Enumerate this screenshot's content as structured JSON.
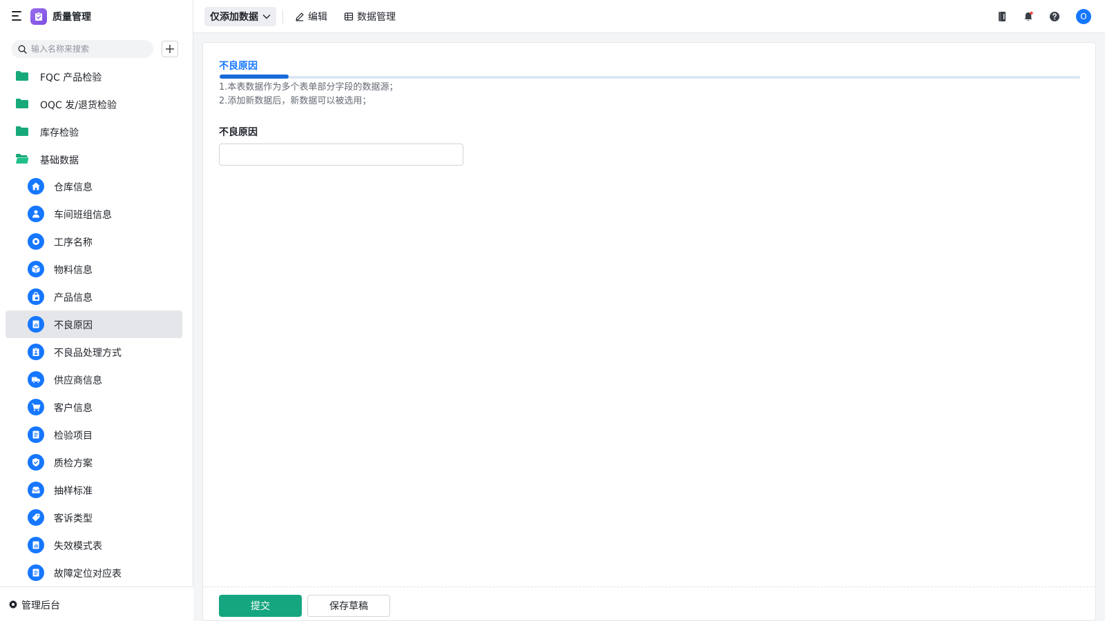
{
  "app": {
    "title": "质量管理",
    "logo_icon": "clipboard-check-icon"
  },
  "search": {
    "placeholder": "输入名称来搜索"
  },
  "sidebar": {
    "folders": [
      {
        "label": "FQC 产品检验"
      },
      {
        "label": "OQC 发/退货检验"
      },
      {
        "label": "库存检验"
      },
      {
        "label": "基础数据"
      }
    ],
    "items": [
      {
        "label": "仓库信息",
        "icon": "home-icon"
      },
      {
        "label": "车间班组信息",
        "icon": "person-icon"
      },
      {
        "label": "工序名称",
        "icon": "gear-icon"
      },
      {
        "label": "物料信息",
        "icon": "box-icon"
      },
      {
        "label": "产品信息",
        "icon": "bag-icon"
      },
      {
        "label": "不良原因",
        "icon": "chart-doc-icon",
        "active": true
      },
      {
        "label": "不良品处理方式",
        "icon": "clipboard-person-icon"
      },
      {
        "label": "供应商信息",
        "icon": "truck-icon"
      },
      {
        "label": "客户信息",
        "icon": "cart-icon"
      },
      {
        "label": "检验项目",
        "icon": "document-icon"
      },
      {
        "label": "质检方案",
        "icon": "shield-check-icon"
      },
      {
        "label": "抽样标准",
        "icon": "inbox-icon"
      },
      {
        "label": "客诉类型",
        "icon": "tag-icon"
      },
      {
        "label": "失效模式表",
        "icon": "chart-doc-icon"
      },
      {
        "label": "故障定位对应表",
        "icon": "document-icon"
      }
    ],
    "footer_label": "管理后台"
  },
  "topbar": {
    "mode_label": "仅添加数据",
    "edit_label": "编辑",
    "data_manage_label": "数据管理",
    "avatar_letter": "O"
  },
  "form": {
    "title": "不良原因",
    "progress": 0.08,
    "desc_lines": [
      "1.本表数据作为多个表单部分字段的数据源；",
      "2.添加新数据后，新数据可以被选用；"
    ],
    "field_label": "不良原因",
    "field_value": "",
    "submit_label": "提交",
    "draft_label": "保存草稿"
  },
  "colors": {
    "accent": "#1677ff",
    "folder": "#18a97b",
    "submit": "#16a67f"
  }
}
